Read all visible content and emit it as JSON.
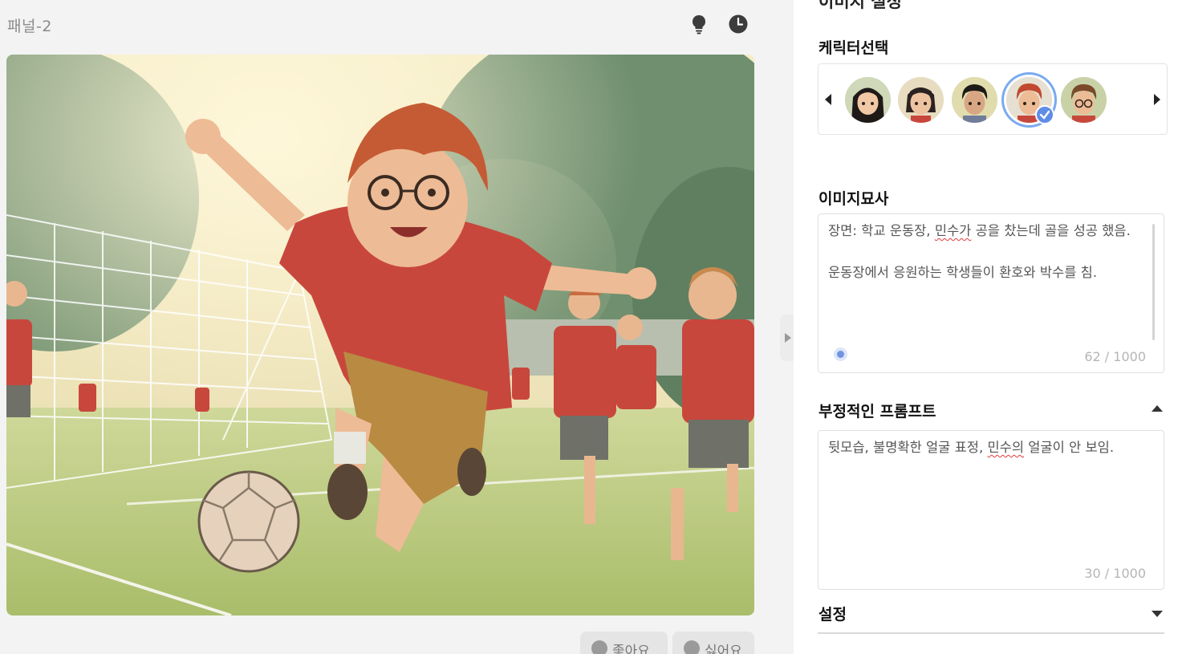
{
  "panel": {
    "title": "패널-2"
  },
  "header_icons": [
    "lightbulb-icon",
    "clock-icon"
  ],
  "reactions": {
    "like_label": "좋아요",
    "dislike_label": "싫어요"
  },
  "settings_panel": {
    "section_title": "이미지 설정",
    "character_select": {
      "label": "케릭터선택",
      "avatars": [
        {
          "name": "avatar-girl-long-hair",
          "selected": false
        },
        {
          "name": "avatar-girl-short-hair",
          "selected": false
        },
        {
          "name": "avatar-boy-dark-curly",
          "selected": false
        },
        {
          "name": "avatar-boy-red-hair",
          "selected": true
        },
        {
          "name": "avatar-boy-glasses",
          "selected": false
        }
      ]
    },
    "image_description": {
      "label": "이미지묘사",
      "text_line1_a": "장면: 학교 운동장, ",
      "text_line1_spell": "민수가",
      "text_line1_b": " 공을 찼는데 골을 성공 했음.",
      "text_line2": "운동장에서 응원하는 학생들이 환호와 박수를 침.",
      "counter": "62 / 1000"
    },
    "negative_prompt": {
      "label": "부정적인 프롬프트",
      "text_a": "뒷모습, 불명확한 얼굴 표정, ",
      "text_spell": "민수의",
      "text_b": " 얼굴이 안 보임.",
      "counter": "30 / 1000"
    },
    "settings": {
      "label": "설정"
    }
  },
  "colors": {
    "accent": "#5f8de6",
    "selected_ring": "#7aaaf0",
    "shirt": "#c8473c"
  }
}
